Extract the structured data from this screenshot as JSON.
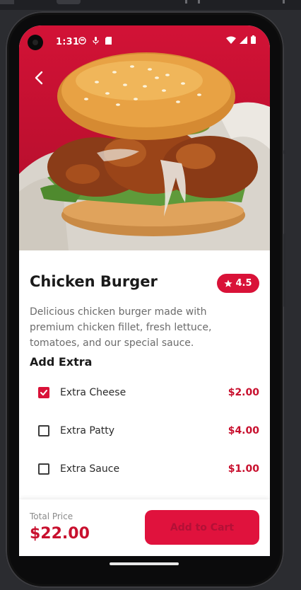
{
  "status": {
    "time": "1:31",
    "icons": [
      "face-icon",
      "mic-icon",
      "sd-card-icon"
    ]
  },
  "product": {
    "title": "Chicken Burger",
    "rating": "4.5",
    "description": "Delicious chicken burger made with premium chicken fillet, fresh lettuce, tomatoes, and our special sauce."
  },
  "extras": {
    "section_title": "Add Extra",
    "items": [
      {
        "name": "Extra Cheese",
        "price": "$2.00",
        "checked": true
      },
      {
        "name": "Extra Patty",
        "price": "$4.00",
        "checked": false
      },
      {
        "name": "Extra Sauce",
        "price": "$1.00",
        "checked": false
      }
    ]
  },
  "footer": {
    "total_label": "Total Price",
    "total_value": "$22.00",
    "cart_button": "Add to Cart"
  },
  "colors": {
    "accent": "#D91238",
    "price": "#C8102E",
    "hero_bg": "#C8102E"
  }
}
